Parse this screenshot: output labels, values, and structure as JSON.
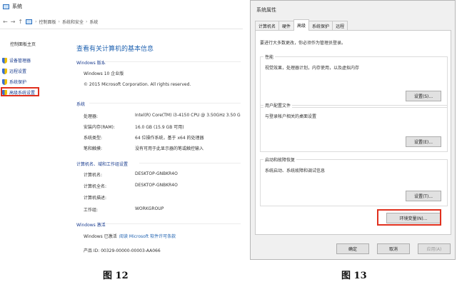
{
  "left": {
    "window_title": "系统",
    "breadcrumb": [
      "控制面板",
      "系统和安全",
      "系统"
    ],
    "sidebar": {
      "home": "控制面板主页",
      "items": [
        {
          "label": "设备管理器"
        },
        {
          "label": "远程设置"
        },
        {
          "label": "系统保护"
        },
        {
          "label": "高级系统设置"
        }
      ]
    },
    "main_title": "查看有关计算机的基本信息",
    "edition": {
      "label": "Windows 版本",
      "name": "Windows 10 企业版",
      "copyright": "© 2015 Microsoft Corporation. All rights reserved."
    },
    "system": {
      "label": "系统",
      "rows": [
        {
          "k": "处理器:",
          "v": "Intel(R) Core(TM) i3-4150 CPU @ 3.50GHz   3.50 G"
        },
        {
          "k": "安装内存(RAM):",
          "v": "16.0 GB (15.9 GB 可用)"
        },
        {
          "k": "系统类型:",
          "v": "64 位操作系统，基于 x64 的处理器"
        },
        {
          "k": "笔和触摸:",
          "v": "没有可用于此显示器的笔或触控输入"
        }
      ]
    },
    "computer": {
      "label": "计算机名、域和工作组设置",
      "rows": [
        {
          "k": "计算机名:",
          "v": "DESKTOP-GNBKR4O"
        },
        {
          "k": "计算机全名:",
          "v": "DESKTOP-GNBKR4O"
        },
        {
          "k": "计算机描述:",
          "v": ""
        },
        {
          "k": "工作组:",
          "v": "WORKGROUP"
        }
      ]
    },
    "activation": {
      "label": "Windows 激活",
      "status": "Windows 已激活",
      "link": "阅读 Microsoft 软件许可条款",
      "product_id": "产品 ID: 00329-00000-00003-AA066"
    }
  },
  "dialog": {
    "title": "系统属性",
    "tabs": [
      "计算机名",
      "硬件",
      "高级",
      "系统保护",
      "远程"
    ],
    "active_tab": 2,
    "admin_note": "要进行大多数更改，你必须作为管理员登录。",
    "groups": [
      {
        "title": "性能",
        "desc": "视觉效果，处理器计划，内存使用，以及虚拟内存",
        "button": "设置(S)..."
      },
      {
        "title": "用户配置文件",
        "desc": "与登录帐户相关的桌面设置",
        "button": "设置(E)..."
      },
      {
        "title": "启动和故障恢复",
        "desc": "系统启动、系统故障和调试信息",
        "button": "设置(T)..."
      }
    ],
    "env_button": "环境变量(N)...",
    "ok": "确定",
    "cancel": "取消",
    "apply": "应用(A)"
  },
  "captions": {
    "left": "图 12",
    "right": "图 13"
  },
  "colors": {
    "highlight": "#e0301e",
    "link": "#1f62b0"
  }
}
